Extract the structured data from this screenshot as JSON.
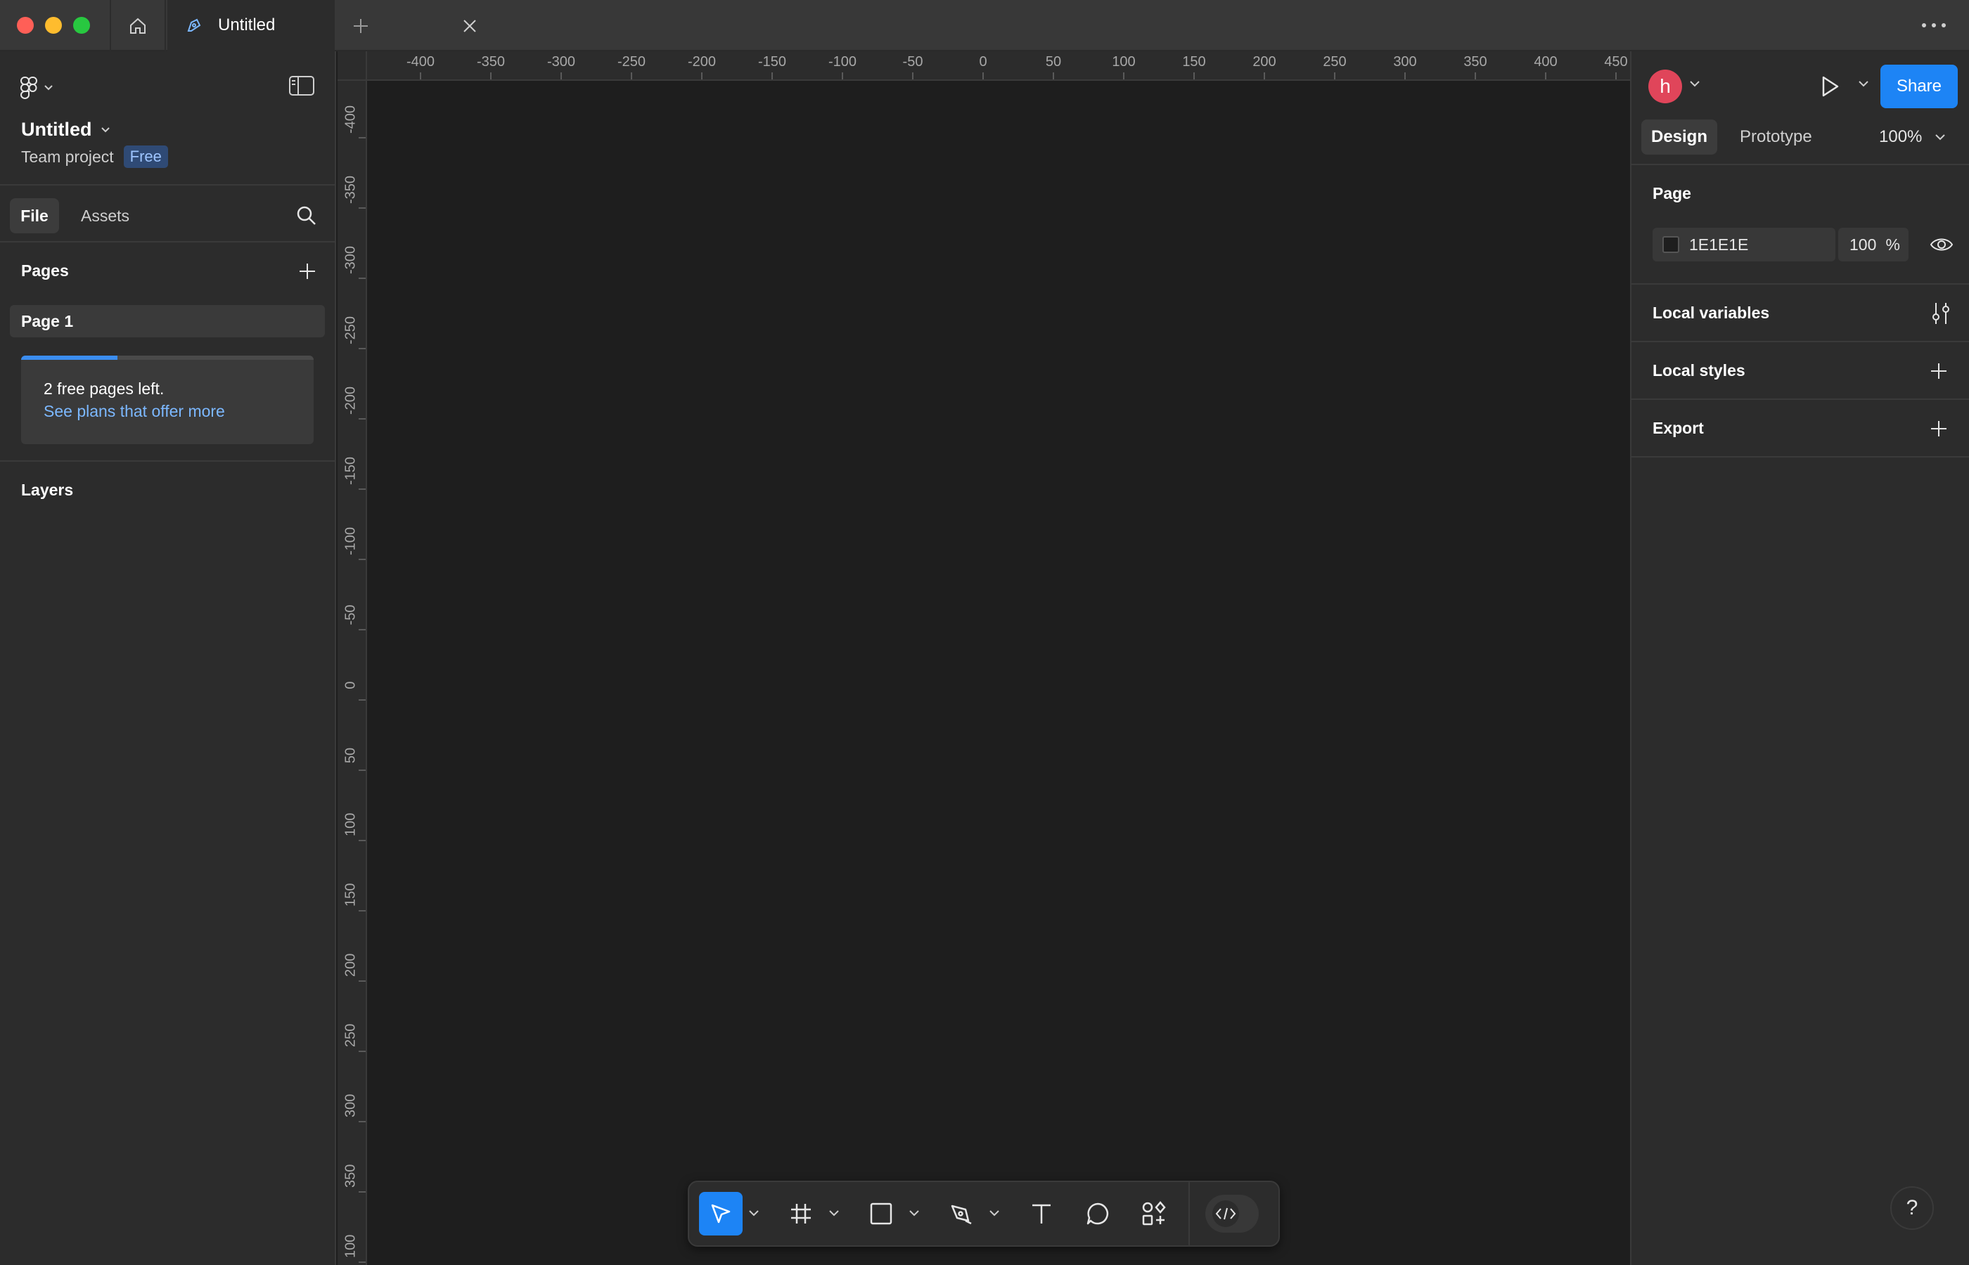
{
  "tabs": {
    "file_tab_label": "Untitled"
  },
  "left_panel": {
    "file_title": "Untitled",
    "project": "Team project",
    "plan_badge": "Free",
    "tabs": {
      "file": "File",
      "assets": "Assets"
    },
    "pages_heading": "Pages",
    "pages": [
      "Page 1"
    ],
    "upsell": {
      "message": "2 free pages left.",
      "link": "See plans that offer more",
      "progress": 0.33
    },
    "layers_heading": "Layers"
  },
  "rulers": {
    "horizontal": [
      "-400",
      "-350",
      "-300",
      "-250",
      "-200",
      "-150",
      "-100",
      "-50",
      "0",
      "50",
      "100",
      "150",
      "200",
      "250",
      "300",
      "350",
      "400",
      "450"
    ],
    "vertical": [
      "-400",
      "-350",
      "-300",
      "-250",
      "-200",
      "-150",
      "-100",
      "-50",
      "0",
      "50",
      "100",
      "150",
      "200",
      "250",
      "300",
      "350",
      "100"
    ]
  },
  "right_panel": {
    "avatar_initial": "h",
    "share_label": "Share",
    "tabs": {
      "design": "Design",
      "prototype": "Prototype"
    },
    "zoom": "100%",
    "page_heading": "Page",
    "page_fill": {
      "hex": "1E1E1E",
      "opacity": "100",
      "unit": "%"
    },
    "local_variables": "Local variables",
    "local_styles": "Local styles",
    "export": "Export"
  },
  "colors": {
    "accent": "#1d84f5",
    "canvas": "#1e1e1e",
    "panel": "#2c2c2c",
    "avatar": "#e0455a"
  },
  "help_label": "?"
}
